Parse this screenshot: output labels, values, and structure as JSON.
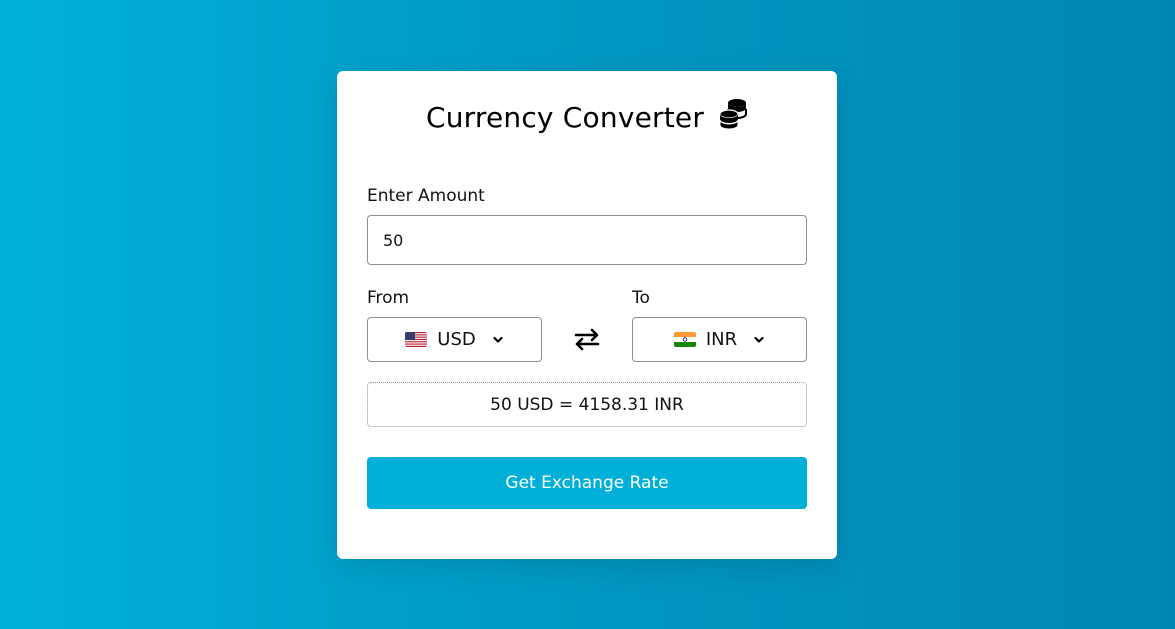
{
  "app": {
    "title": "Currency Converter",
    "title_icon": "coins-icon",
    "accent_color": "#00b0d8"
  },
  "amount": {
    "label": "Enter Amount",
    "value": "50"
  },
  "from": {
    "label": "From",
    "currency": "USD",
    "flag_icon": "us-flag-icon"
  },
  "to": {
    "label": "To",
    "currency": "INR",
    "flag_icon": "india-flag-icon"
  },
  "swap_icon": "swap-arrows-icon",
  "result": {
    "text": "50 USD = 4158.31 INR"
  },
  "action": {
    "label": "Get Exchange Rate"
  }
}
